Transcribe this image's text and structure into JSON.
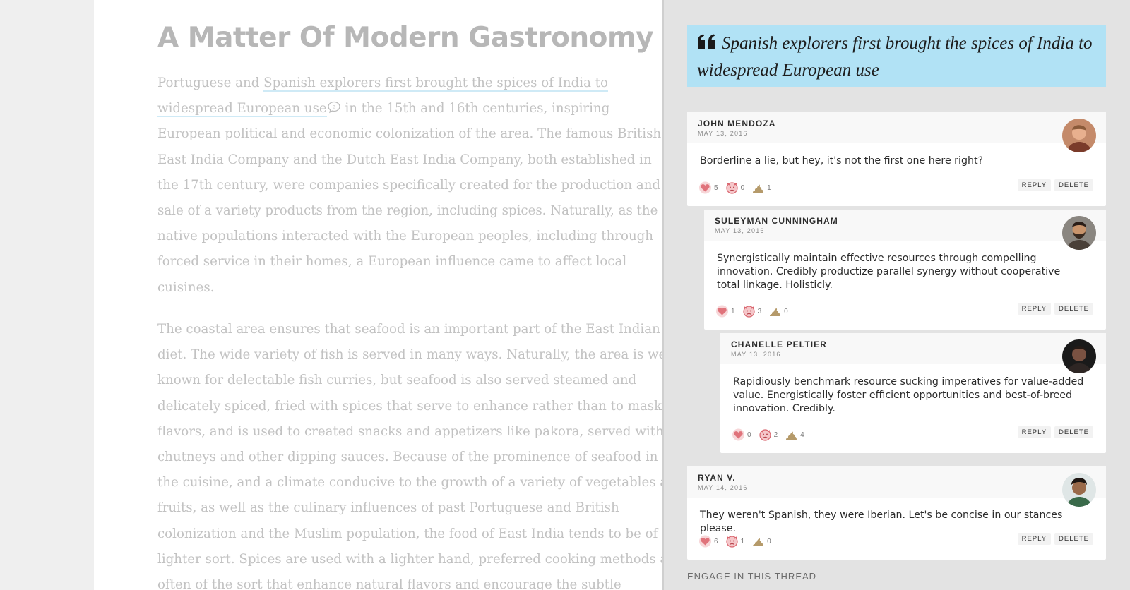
{
  "article": {
    "title": "A Matter Of Modern Gastronomy",
    "paragraph1": {
      "before_highlight": "Portuguese and ",
      "highlight_line1": "Spanish explorers first brought the spices of India to",
      "highlight_line2": "widespread European use",
      "annotation_count": "3",
      "line2_rest": " in the 15th and 16th centuries, inspiring",
      "lines": [
        "European political and economic colonization of the area. The famous British",
        "East India Company and the Dutch East India Company, both established in",
        "the 17th century, were companies specifically created for the production and",
        "sale of a variety products from the region, including spices. Naturally, as the",
        "native populations interacted with the European peoples, including through",
        "forced service in their homes, a European influence came to affect local",
        "cuisines."
      ]
    },
    "paragraph2": {
      "lines": [
        "The coastal area ensures that seafood is an important part of the East Indian",
        "diet. The wide variety of fish is served in many ways. Naturally, the area is well",
        "known for delectable fish curries, but seafood is also served steamed and",
        "delicately spiced, fried with spices that serve to enhance rather than to mask",
        "flavors, and is used to created snacks and appetizers like pakora, served with",
        "chutneys and other dipping sauces. Because of the prominence of seafood in",
        "the cuisine, and a climate conducive to the growth of a variety of vegetables and",
        "fruits, as well as the culinary influences of past Portuguese and British",
        "colonization and the Muslim population, the food of East India tends to be of a",
        "lighter sort. Spices are used with a lighter hand, preferred cooking methods are",
        "often of the sort that enhance natural flavors and encourage the subtle"
      ]
    }
  },
  "quote": {
    "text": "Spanish explorers first brought the spices of India to widespread European use"
  },
  "labels": {
    "reply": "REPLY",
    "delete": "DELETE",
    "engage": "ENGAGE IN THIS THREAD"
  },
  "comments": [
    {
      "name": "JOHN MENDOZA",
      "date": "MAY 13, 2016",
      "body": "Borderline a lie, but hey, it's not the first one here right?",
      "reactions": {
        "heart": "5",
        "angry": "0",
        "poop": "1"
      },
      "avatar_color": "#b06a4a"
    },
    {
      "name": "SULEYMAN CUNNINGHAM",
      "date": "MAY 13, 2016",
      "body": "Synergistically maintain effective resources through compelling innovation. Credibly productize parallel synergy without cooperative total linkage. Holisticly.",
      "reactions": {
        "heart": "1",
        "angry": "3",
        "poop": "0"
      },
      "avatar_color": "#5d4a3e"
    },
    {
      "name": "CHANELLE PELTIER",
      "date": "MAY 13, 2016",
      "body": "Rapidiously benchmark resource sucking imperatives for value-added value. Energistically foster efficient opportunities and best-of-breed innovation. Credibly.",
      "reactions": {
        "heart": "0",
        "angry": "2",
        "poop": "4"
      },
      "avatar_color": "#3b2e2a"
    },
    {
      "name": "RYAN V.",
      "date": "MAY 14, 2016",
      "body": "They weren't Spanish, they were Iberian. Let's be concise in our stances please.",
      "reactions": {
        "heart": "6",
        "angry": "1",
        "poop": "0"
      },
      "avatar_color": "#6a4a34"
    }
  ],
  "colors": {
    "quote_bg": "#b1e2f5",
    "heart": "#e0737b",
    "angry": "#e0737b",
    "poop": "#b59a6a",
    "highlight_underline": "#cfeaf6"
  }
}
